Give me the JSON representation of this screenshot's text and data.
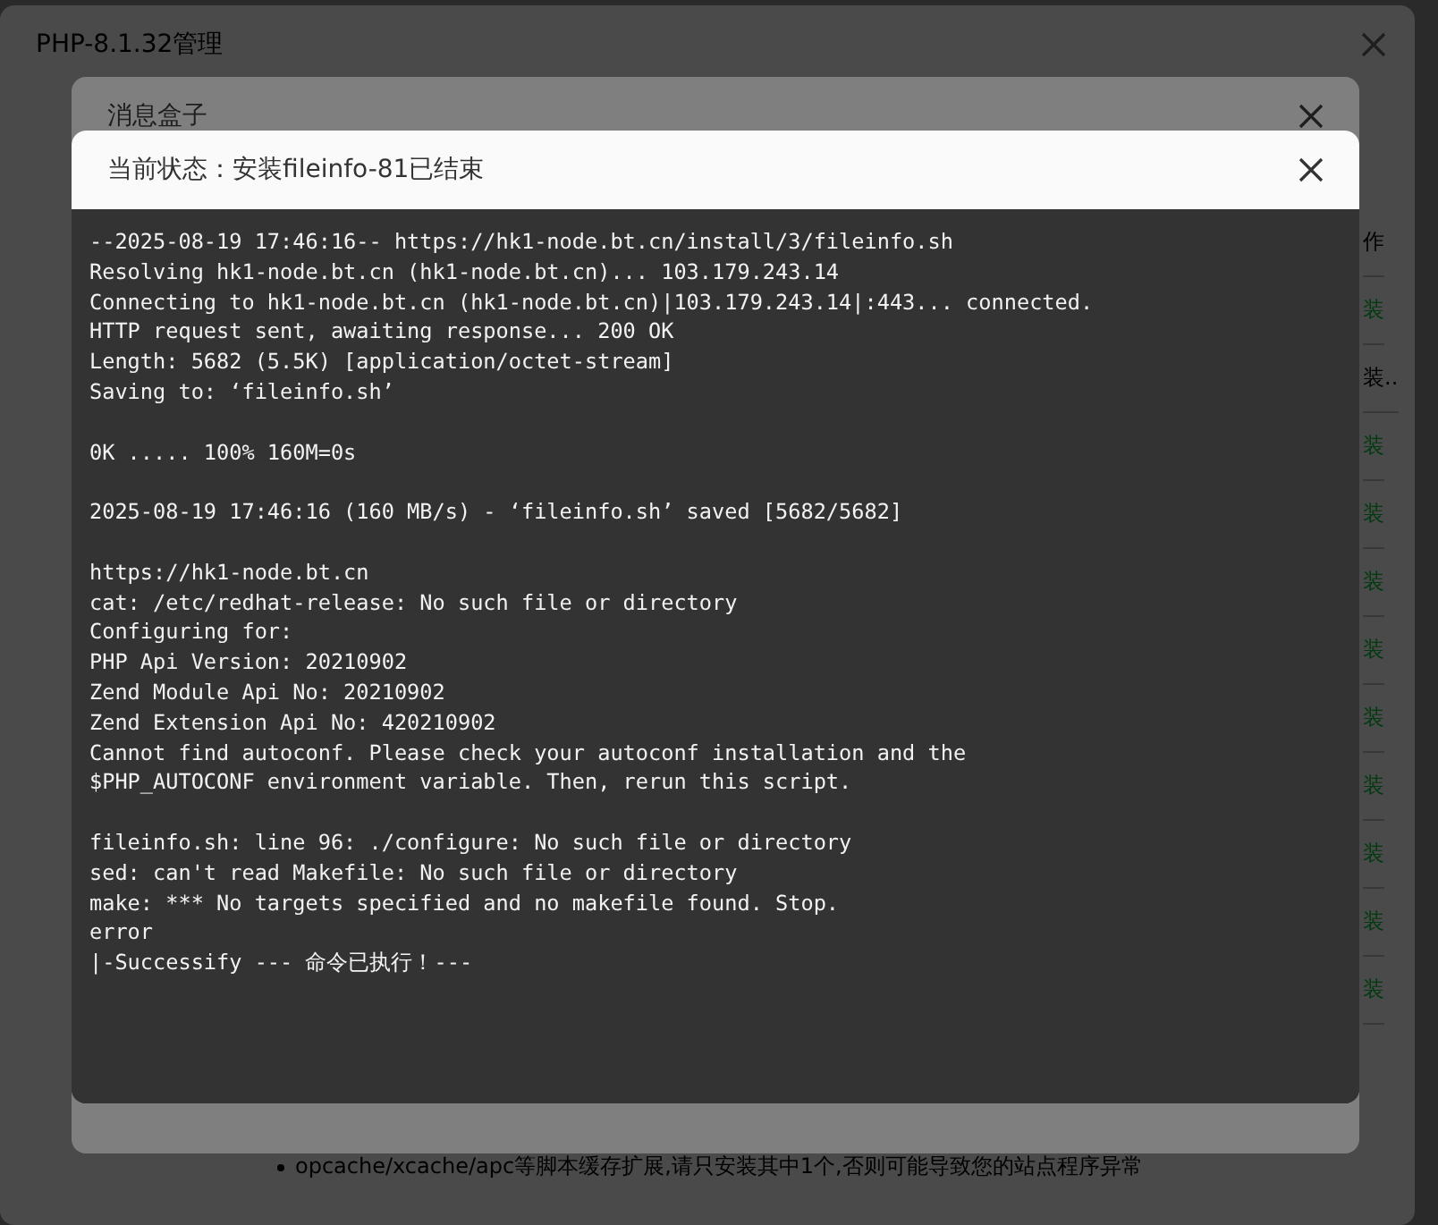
{
  "window": {
    "title": "PHP-8.1.32管理"
  },
  "table": {
    "header": "作",
    "rows": [
      {
        "action": "装",
        "kind": "done"
      },
      {
        "action": "装..",
        "kind": "busy"
      },
      {
        "action": "装",
        "kind": "done"
      },
      {
        "action": "装",
        "kind": "done"
      },
      {
        "action": "装",
        "kind": "done"
      },
      {
        "action": "装",
        "kind": "done"
      },
      {
        "action": "装",
        "kind": "done"
      },
      {
        "action": "装",
        "kind": "done"
      },
      {
        "action": "装",
        "kind": "done"
      },
      {
        "action": "装",
        "kind": "done"
      },
      {
        "action": "装",
        "kind": "done"
      }
    ]
  },
  "note": "opcache/xcache/apc等脚本缓存扩展,请只安装其中1个,否则可能导致您的站点程序异常",
  "message_box": {
    "title": "消息盒子"
  },
  "status_dialog": {
    "title": "当前状态：安装fileinfo-81已结束",
    "log": [
      [
        "--2025-08-19 17:46:16-- https://hk1-node.bt.cn/install/3/fileinfo.sh",
        "Resolving hk1-node.bt.cn (hk1-node.bt.cn)... 103.179.243.14",
        "Connecting to hk1-node.bt.cn (hk1-node.bt.cn)|103.179.243.14|:443... connected.",
        "HTTP request sent, awaiting response... 200 OK",
        "Length: 5682 (5.5K) [application/octet-stream]",
        "Saving to: ‘fileinfo.sh’"
      ],
      [
        "0K ..... 100% 160M=0s"
      ],
      [
        "2025-08-19 17:46:16 (160 MB/s) - ‘fileinfo.sh’ saved [5682/5682]"
      ],
      [
        "https://hk1-node.bt.cn",
        "cat: /etc/redhat-release: No such file or directory",
        "Configuring for:",
        "PHP Api Version: 20210902",
        "Zend Module Api No: 20210902",
        "Zend Extension Api No: 420210902",
        "Cannot find autoconf. Please check your autoconf installation and the",
        "$PHP_AUTOCONF environment variable. Then, rerun this script."
      ],
      [
        "fileinfo.sh: line 96: ./configure: No such file or directory",
        "sed: can't read Makefile: No such file or directory",
        "make: *** No targets specified and no makefile found. Stop.",
        "error",
        "|-Successify --- 命令已执行！---"
      ]
    ]
  }
}
